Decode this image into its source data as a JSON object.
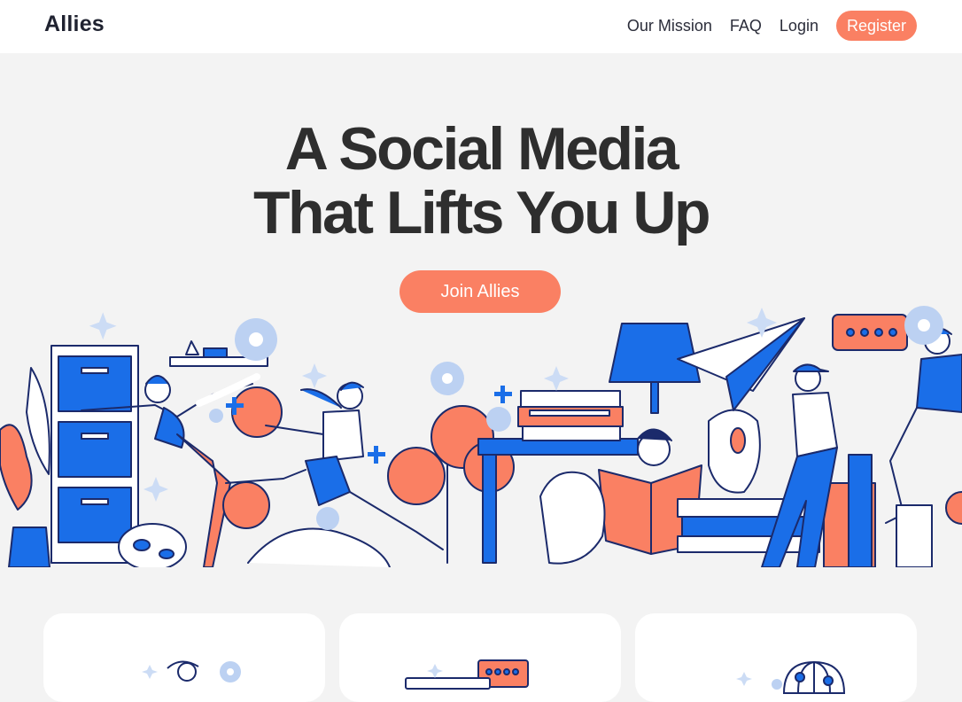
{
  "header": {
    "logo": "Allies",
    "nav": [
      {
        "label": "Our Mission"
      },
      {
        "label": "FAQ"
      },
      {
        "label": "Login"
      }
    ],
    "register_label": "Register"
  },
  "hero": {
    "title_line1": "A Social Media",
    "title_line2": "That Lifts You Up",
    "cta_label": "Join Allies"
  },
  "colors": {
    "accent": "#fa8063",
    "blue": "#1a6ee8",
    "navy": "#1b2a6b",
    "background": "#f3f3f3"
  }
}
